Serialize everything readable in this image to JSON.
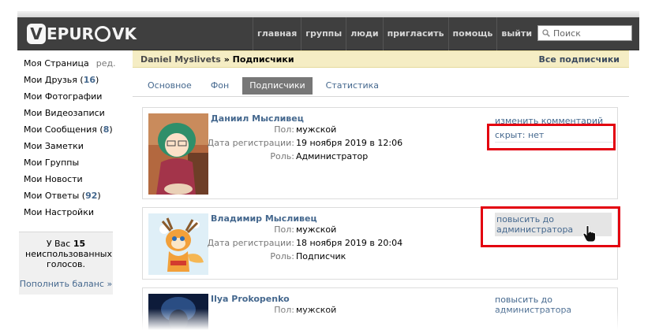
{
  "header": {
    "logo_text": "EPUR",
    "logo_suffix": "VK",
    "nav": [
      "главная",
      "группы",
      "люди",
      "пригласить",
      "помощь",
      "выйти"
    ],
    "search_placeholder": "Поиск"
  },
  "sidebar": {
    "items": [
      {
        "label": "Моя Страница",
        "extra": "ред."
      },
      {
        "label": "Мои Друзья",
        "count": "16"
      },
      {
        "label": "Мои Фотографии"
      },
      {
        "label": "Мои Видеозаписи"
      },
      {
        "label": "Мои Сообщения",
        "count": "8"
      },
      {
        "label": "Мои Заметки"
      },
      {
        "label": "Мои Группы"
      },
      {
        "label": "Мои Новости"
      },
      {
        "label": "Мои Ответы",
        "count": "92"
      },
      {
        "label": "Мои Настройки"
      }
    ],
    "votes": {
      "prefix": "У Вас",
      "count": "15",
      "suffix": "неиспользованных голосов.",
      "topup": "Пополнить баланс »"
    }
  },
  "main": {
    "breadcrumb_name": "Daniel Myslivets",
    "breadcrumb_sep": "»",
    "breadcrumb_page": "Подписчики",
    "all_link": "Все подписчики",
    "tabs": [
      {
        "label": "Основное"
      },
      {
        "label": "Фон"
      },
      {
        "label": "Подписчики"
      },
      {
        "label": "Статистика"
      }
    ],
    "labels": {
      "gender": "Пол:",
      "registered": "Дата регистрации:",
      "role": "Роль:"
    },
    "members": [
      {
        "name": "Даниил Мысливец",
        "gender": "мужской",
        "registered": "19 ноября 2019 в 12:06",
        "role": "Администратор",
        "action": "изменить комментарий",
        "action2": "скрыт: нет"
      },
      {
        "name": "Владимир Мысливец",
        "gender": "мужской",
        "registered": "18 ноября 2019 в 20:04",
        "role": "Подписчик",
        "action": "повысить до администратора"
      },
      {
        "name": "Ilya Prokopenko",
        "gender": "мужской",
        "action": "повысить до администратора"
      }
    ]
  },
  "colors": {
    "header_bg": "#3f3f3f",
    "link": "#45688e",
    "highlight": "#e3000f",
    "breadcrumb_bg": "#f5edc4"
  }
}
